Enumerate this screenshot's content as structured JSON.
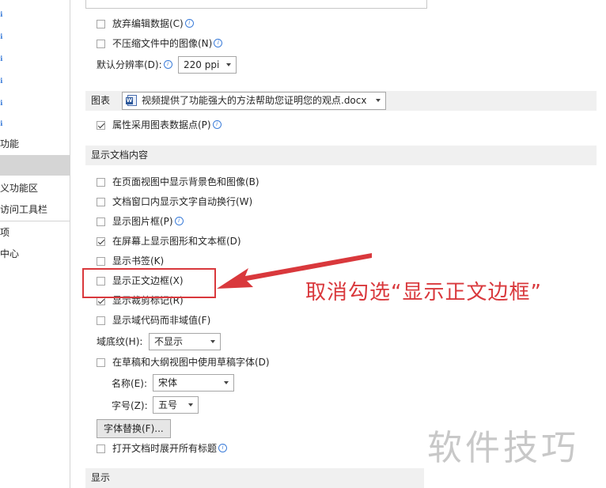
{
  "sidebar": {
    "items": [
      {
        "label": "ℹ"
      },
      {
        "label": "ℹ"
      },
      {
        "label": "ℹ"
      },
      {
        "label": "ℹ"
      },
      {
        "label": "ℹ"
      },
      {
        "label": "ℹ"
      },
      {
        "label": "功能"
      },
      {
        "label": ""
      },
      {
        "label": "义功能区"
      },
      {
        "label": "访问工具栏"
      },
      {
        "label": "项"
      },
      {
        "label": "中心"
      }
    ]
  },
  "image_options": {
    "discard_edit_data": "放弃编辑数据(C)",
    "no_compress": "不压缩文件中的图像(N)",
    "default_resolution_label": "默认分辨率(D):",
    "default_resolution_value": "220 ppi"
  },
  "chart_section": {
    "label": "图表",
    "document_value": "视频提供了功能强大的方法帮助您证明您的观点.docx",
    "property_follow": "属性采用图表数据点(P)"
  },
  "show_doc_content": {
    "header": "显示文档内容",
    "options": [
      {
        "label": "在页面视图中显示背景色和图像(B)",
        "checked": false
      },
      {
        "label": "文档窗口内显示文字自动换行(W)",
        "checked": false
      },
      {
        "label": "显示图片框(P)",
        "checked": false
      },
      {
        "label": "在屏幕上显示图形和文本框(D)",
        "checked": true
      },
      {
        "label": "显示书签(K)",
        "checked": false
      },
      {
        "label": "显示正文边框(X)",
        "checked": false
      },
      {
        "label": "显示裁剪标记(R)",
        "checked": true
      },
      {
        "label": "显示域代码而非域值(F)",
        "checked": false
      }
    ],
    "field_shading_label": "域底纹(H):",
    "field_shading_value": "不显示",
    "draft_font_option": "在草稿和大纲视图中使用草稿字体(D)",
    "name_label": "名称(E):",
    "name_value": "宋体",
    "size_label": "字号(Z):",
    "size_value": "五号",
    "font_substitute_button": "字体替换(F)...",
    "expand_headings": "打开文档时展开所有标题"
  },
  "display_section": {
    "header": "显示"
  },
  "annotation": {
    "text": "取消勾选“显示正文边框”",
    "color": "#d9383c"
  },
  "watermark": {
    "text": "软件技巧"
  }
}
